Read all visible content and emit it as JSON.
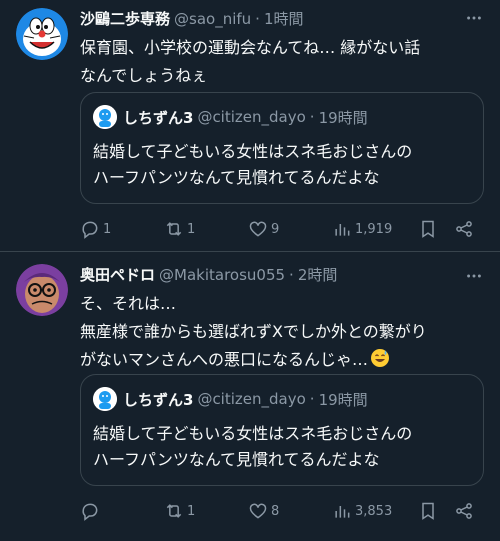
{
  "posts": [
    {
      "author": {
        "name": "沙鷗二歩専務",
        "handle": "@sao_nifu"
      },
      "separator": "·",
      "time": "1時間",
      "lines": [
        "保育園、小学校の運動会なんてね… 縁がない話",
        "なんでしょうねぇ"
      ],
      "quote": {
        "author": {
          "name": "しちずん3",
          "handle": "@citizen_dayo"
        },
        "time": "19時間",
        "lines": [
          "結婚して子どもいる女性はスネ毛おじさんの",
          "ハーフパンツなんて見慣れてるんだよな"
        ]
      },
      "stats": {
        "replies": "1",
        "reposts": "1",
        "likes": "9",
        "views": "1,919"
      }
    },
    {
      "author": {
        "name": "奥田ペドロ",
        "handle": "@Makitarosu055"
      },
      "separator": "·",
      "time": "2時間",
      "lines": [
        "そ、それは…",
        "無産様で誰からも選ばれずXでしか外との繋がり",
        "がないマンさんへの悪口になるんじゃ…"
      ],
      "quote": {
        "author": {
          "name": "しちずん3",
          "handle": "@citizen_dayo"
        },
        "time": "19時間",
        "lines": [
          "結婚して子どもいる女性はスネ毛おじさんの",
          "ハーフパンツなんて見慣れてるんだよな"
        ]
      },
      "stats": {
        "replies": "",
        "reposts": "1",
        "likes": "8",
        "views": "3,853"
      }
    }
  ],
  "icons": {
    "more": "more-icon",
    "reply": "reply-icon",
    "repost": "repost-icon",
    "like": "heart-icon",
    "views": "views-icon",
    "bookmark": "bookmark-icon",
    "share": "share-icon",
    "emoji": "sweat-smile-emoji"
  },
  "colors": {
    "background": "#15202b",
    "muted": "#8b98a5",
    "border": "#38444d",
    "text": "#f7f9f9"
  }
}
